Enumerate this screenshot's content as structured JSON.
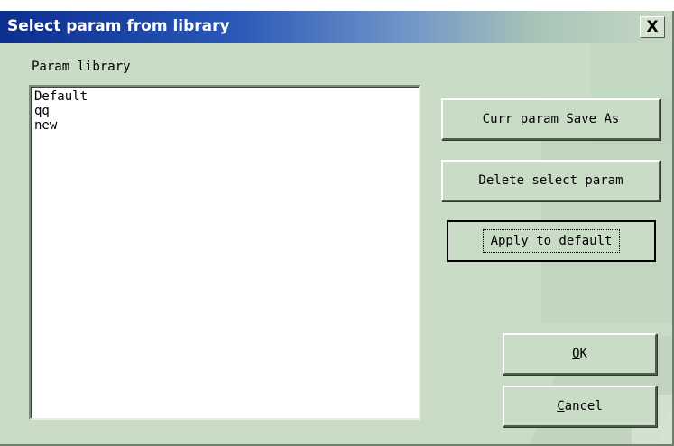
{
  "window": {
    "title": "Select param from library",
    "close_label": "X"
  },
  "library": {
    "label": "Param library",
    "items": [
      "Default",
      "qq",
      "new"
    ]
  },
  "buttons": {
    "save_as": "Curr param Save As",
    "delete": "Delete select param",
    "apply_prefix": "Apply to ",
    "apply_accel": "d",
    "apply_suffix": "efault",
    "ok_accel": "O",
    "ok_suffix": "K",
    "cancel_accel": "C",
    "cancel_suffix": "ancel"
  },
  "colors": {
    "dialog_bg": "#c9dcc6",
    "title_bar_start": "#0c2e8f",
    "list_bg": "#ffffff"
  }
}
